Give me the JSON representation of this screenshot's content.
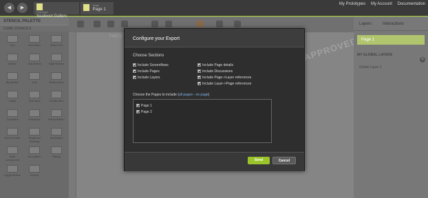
{
  "topbar": {
    "crumb1_small": "Prototype",
    "crumb1": "Seatpool Gallery",
    "crumb2_small": "Page",
    "crumb2": "Page 1",
    "links": [
      "My Prototypes",
      "My Account",
      "Documentation"
    ]
  },
  "left": {
    "title": "STENCIL PALETTE",
    "group": "CORE STENCILS",
    "stencils": [
      "Text",
      "Text Block",
      "Head Text",
      "Button",
      "Link Button",
      "Right Button",
      "Big Button",
      "Link",
      "Button Area",
      "Image",
      "Text Input",
      "Combo Box",
      "Comment",
      "Checkbox",
      "Radio Button",
      "Scroll Frame",
      "Positional Drawing",
      "Tab Button",
      "Note component",
      "Annotation",
      "Rating",
      "Toggle Button",
      "Search"
    ]
  },
  "canvas": {
    "placeholder": "Empty",
    "stamp": "APPROVED"
  },
  "right": {
    "tabs": [
      "Layers",
      "Interactions"
    ],
    "page": "Page 1",
    "global": "MY GLOBAL LAYERS",
    "layer": "Global Layer 1"
  },
  "dialog": {
    "title": "Configure your Export",
    "sections_label": "Choose Sections",
    "left_options": [
      "Include Screenflows",
      "Include Pages",
      "Include Layers"
    ],
    "right_options": [
      "Include Page details",
      "Include Discussions",
      "Include Page->Layer references",
      "Include Layer->Page references"
    ],
    "pages_label": "Choose the Pages to include (",
    "all_pages": "all pages",
    "sep": " - ",
    "no_page": "no page",
    "close_paren": ")",
    "pages": [
      "Page 1",
      "Page 2"
    ],
    "send": "Send",
    "cancel": "Cancel"
  },
  "colors": {
    "accent": "#9bc42b",
    "link": "#7fb5e8"
  }
}
